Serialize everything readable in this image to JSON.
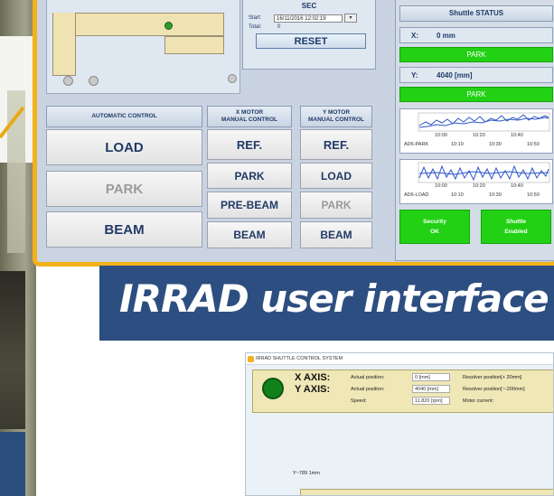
{
  "map": {},
  "sec": {
    "title": "SEC",
    "start_label": "Start:",
    "start_value": "16/11/2016 12:02:19",
    "total_label": "Total:",
    "total_value": "0",
    "reset_label": "RESET"
  },
  "auto": {
    "header": "AUTOMATIC CONTROL",
    "load": "LOAD",
    "park": "PARK",
    "beam": "BEAM"
  },
  "xmotor": {
    "header_1": "X MOTOR",
    "header_2": "MANUAL CONTROL",
    "ref": "REF.",
    "park": "PARK",
    "prebeam": "PRE-BEAM",
    "beam": "BEAM"
  },
  "ymotor": {
    "header_1": "Y MOTOR",
    "header_2": "MANUAL CONTROL",
    "ref": "REF.",
    "load": "LOAD",
    "park": "PARK",
    "beam": "BEAM"
  },
  "status": {
    "title": "Shuttle STATUS",
    "x_label": "X:",
    "x_value": "0 mm",
    "x_state": "PARK",
    "y_label": "Y:",
    "y_value": "4040 [mm]",
    "y_state": "PARK",
    "chart1": {
      "ticks_top": [
        "10:00",
        "10:20",
        "10:40"
      ],
      "name": "AD6-PARK",
      "ticks_bottom": [
        "10:10",
        "10:30",
        "10:50"
      ]
    },
    "chart2": {
      "ticks_top": [
        "10:00",
        "10:20",
        "10:40"
      ],
      "name": "AD6-LOAD",
      "ticks_bottom": [
        "10:10",
        "10:30",
        "10:50"
      ]
    },
    "security_1": "Security",
    "security_2": "OK",
    "shuttle_1": "Shuttle",
    "shuttle_2": "Enabled"
  },
  "banner": {
    "title": "IRRAD user interface"
  },
  "win2": {
    "title": "IRRAD SHUTTLE CONTROL SYSTEM",
    "x_axis": "X AXIS:",
    "y_axis": "Y AXIS:",
    "actual_position": "Actual position:",
    "x_pos_value": "0 [mm]",
    "y_pos_value": "4040 [mm]",
    "speed_label": "Speed:",
    "speed_value": "11.820 [rpm]",
    "resolver_x": "Resolver position[+ 20mm]",
    "resolver_y": "Resolver position[~-200mm]",
    "motor_current": "Motor current:",
    "y_readout": "Y~789 1mm"
  },
  "colors": {
    "frame": "#f3b11a",
    "status_green": "#22d114",
    "banner_blue": "#2d4e80",
    "button_text": "#213a66"
  }
}
